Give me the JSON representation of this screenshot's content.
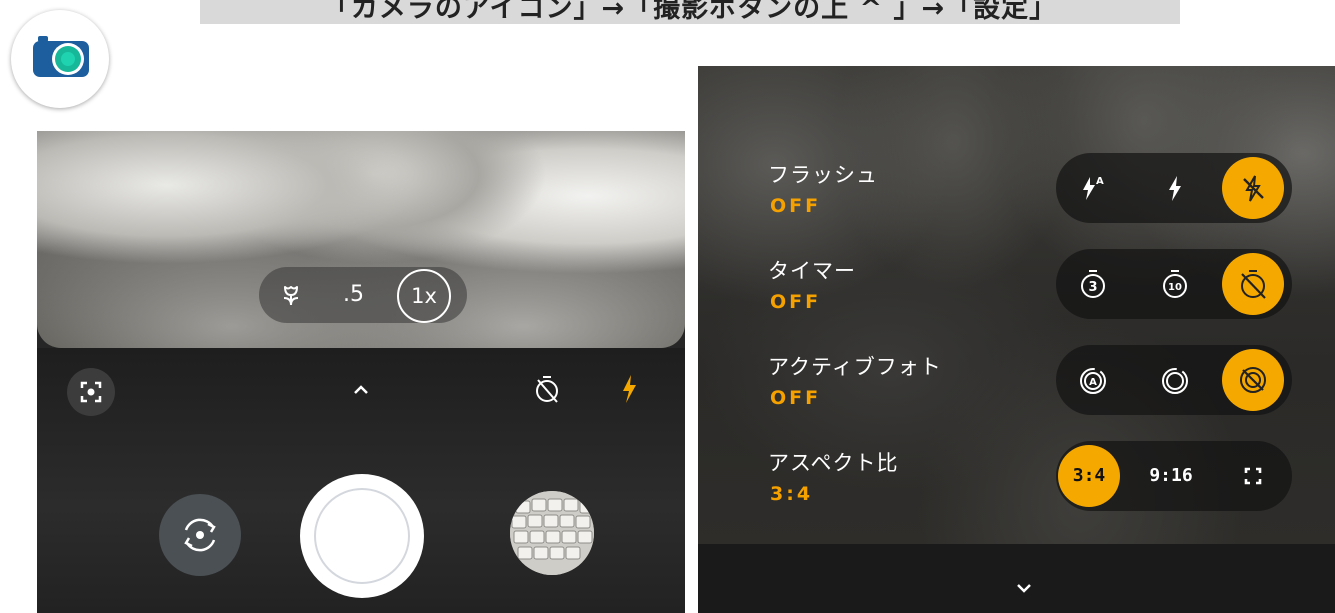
{
  "banner": {
    "text": "「カメラのアイコン」→「撮影ボタンの上 ^ 」→「設定」"
  },
  "colors": {
    "accent": "#f5a800",
    "accent_text": "#f5a100"
  },
  "left_phone": {
    "zoom": {
      "macro_icon": "flower-icon",
      "half": ".5",
      "one": "1x"
    },
    "toolbar": {
      "lens_icon": "lens-focus-icon",
      "expand_icon": "chevron-up-icon",
      "timer_icon": "timer-off-icon",
      "flash_icon": "flash-icon"
    },
    "bottom": {
      "flip_icon": "camera-flip-icon",
      "shutter": "shutter-button",
      "thumbnail": "gallery-thumbnail"
    }
  },
  "settings": {
    "flash": {
      "label": "フラッシュ",
      "value": "OFF",
      "options": [
        "flash-auto-icon",
        "flash-on-icon",
        "flash-off-icon"
      ],
      "selected": 2
    },
    "timer": {
      "label": "タイマー",
      "value": "OFF",
      "options": [
        "timer-3-icon",
        "timer-10-icon",
        "timer-off-icon"
      ],
      "selected": 2
    },
    "active_photo": {
      "label": "アクティブフォト",
      "value": "OFF",
      "options": [
        "active-photo-auto-icon",
        "active-photo-on-icon",
        "active-photo-off-icon"
      ],
      "selected": 2
    },
    "aspect": {
      "label": "アスペクト比",
      "value": "3:4",
      "options": [
        "3:4",
        "9:16",
        "full-screen-icon"
      ],
      "selected": 0
    }
  },
  "right_bottom": {
    "collapse_icon": "chevron-down-icon"
  }
}
